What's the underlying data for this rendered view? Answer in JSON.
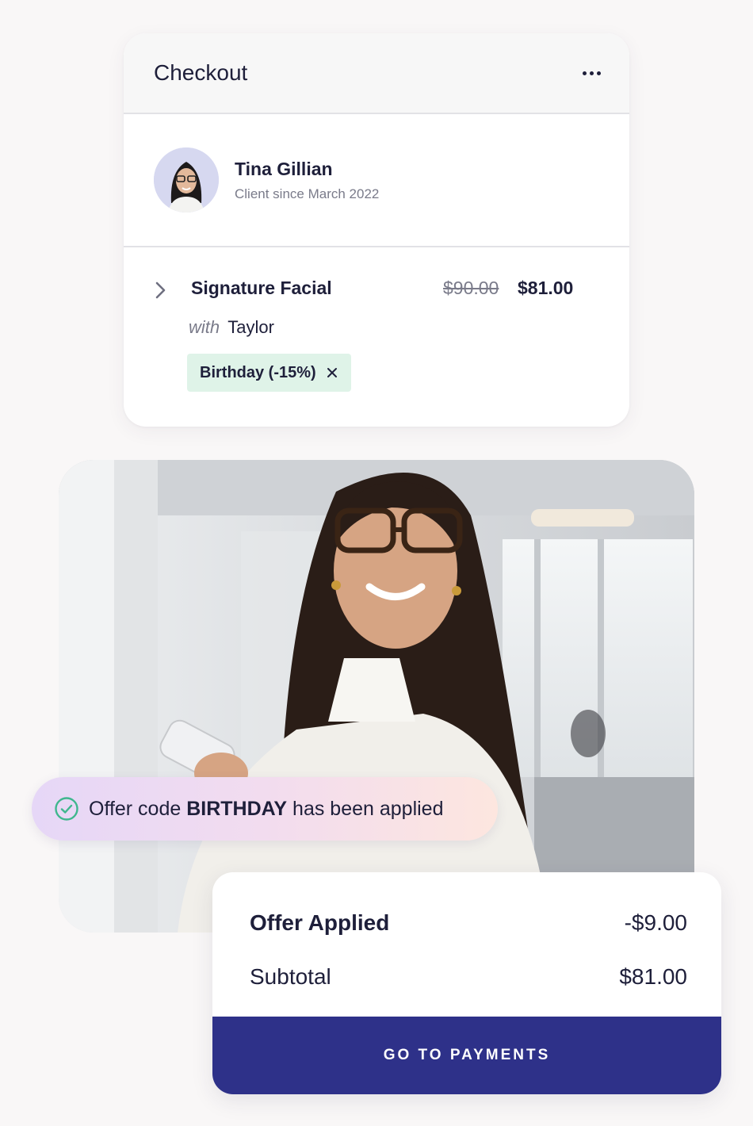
{
  "checkout": {
    "title": "Checkout",
    "menu_icon": "more-horizontal-icon",
    "client": {
      "name": "Tina Gillian",
      "since": "Client since March 2022"
    },
    "service": {
      "name": "Signature Facial",
      "original_price": "$90.00",
      "price": "$81.00",
      "with_label": "with",
      "staff": "Taylor",
      "discount_chip": "Birthday (-15%)"
    }
  },
  "toast": {
    "prefix": "Offer code ",
    "code": "BIRTHDAY",
    "suffix": " has been applied",
    "icon": "check-circle-icon"
  },
  "summary": {
    "offer_label": "Offer Applied",
    "offer_value": "-$9.00",
    "subtotal_label": "Subtotal",
    "subtotal_value": "$81.00",
    "button_label": "GO TO PAYMENTS"
  },
  "colors": {
    "brand_primary": "#2e3189",
    "chip_background": "#dff3e8",
    "check_green": "#3fb78e",
    "text_dark": "#1e1f3a",
    "text_muted": "#7a7b8a"
  }
}
